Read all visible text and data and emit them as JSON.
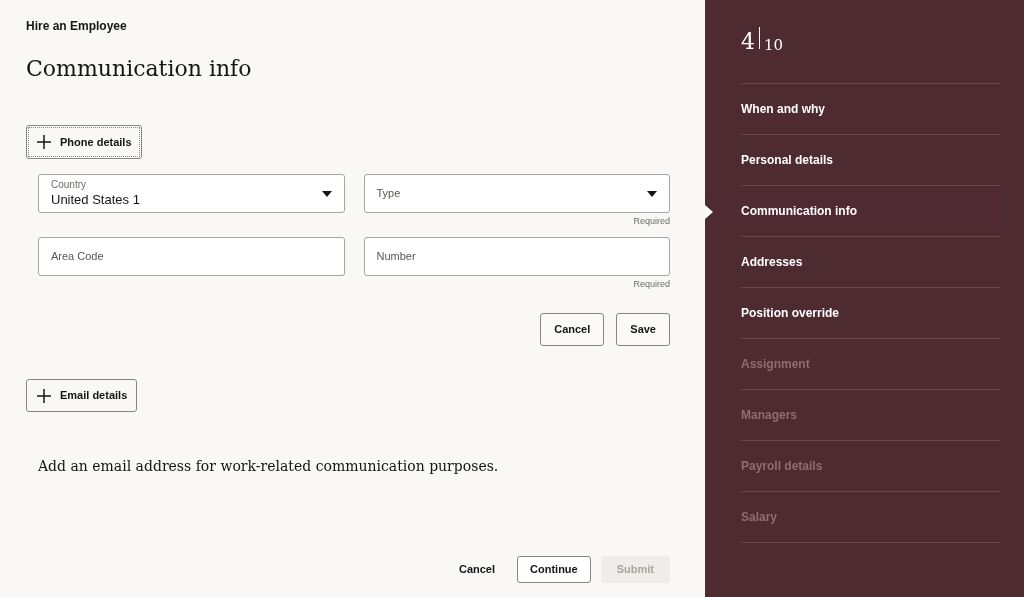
{
  "header": {
    "task": "Hire an Employee",
    "title": "Communication info"
  },
  "phone_section": {
    "button": "Phone details",
    "fields": [
      {
        "kind": "dropdown",
        "label": "Country",
        "value": "United States 1"
      },
      {
        "kind": "dropdown",
        "placeholder": "Type",
        "hint": "Required"
      },
      {
        "kind": "text",
        "placeholder": "Area Code"
      },
      {
        "kind": "text",
        "placeholder": "Number",
        "hint": "Required"
      }
    ],
    "actions": [
      {
        "label": "Cancel"
      },
      {
        "label": "Save"
      }
    ]
  },
  "email_section": {
    "button": "Email details",
    "message": "Add an email address for work-related communication purposes."
  },
  "footer": [
    {
      "label": "Cancel",
      "kind": "link",
      "disabled": false
    },
    {
      "label": "Continue",
      "kind": "outline",
      "disabled": false
    },
    {
      "label": "Submit",
      "kind": "solid",
      "disabled": true
    }
  ],
  "progress": {
    "current": "4",
    "total": "10",
    "steps": [
      {
        "label": "When and why",
        "selected": false,
        "disabled": false
      },
      {
        "label": "Personal details",
        "selected": false,
        "disabled": false
      },
      {
        "label": "Communication info",
        "selected": true,
        "disabled": false
      },
      {
        "label": "Addresses",
        "selected": false,
        "disabled": false
      },
      {
        "label": "Position override",
        "selected": false,
        "disabled": false
      },
      {
        "label": "Assignment",
        "selected": false,
        "disabled": true
      },
      {
        "label": "Managers",
        "selected": false,
        "disabled": true
      },
      {
        "label": "Payroll details",
        "selected": false,
        "disabled": true
      },
      {
        "label": "Salary",
        "selected": false,
        "disabled": true
      }
    ]
  }
}
